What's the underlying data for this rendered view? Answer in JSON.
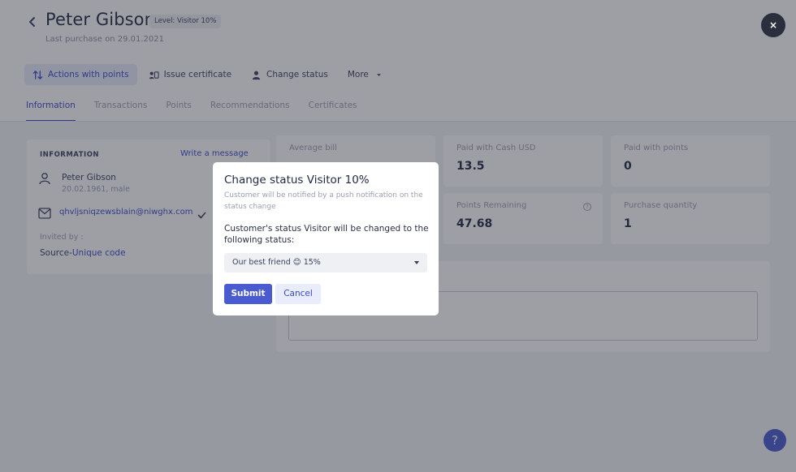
{
  "header": {
    "title": "Peter Gibson",
    "level_badge": "Level: Visitor 10%",
    "last_purchase": "Last purchase on 29.01.2021",
    "close_label": "×"
  },
  "actions": [
    {
      "label": "Actions with points",
      "icon": "swap-arrows-icon"
    },
    {
      "label": "Issue certificate",
      "icon": "ticket-icon"
    },
    {
      "label": "Change status",
      "icon": "user-badge-icon"
    },
    {
      "label": "More",
      "icon": "caret-down-icon"
    }
  ],
  "tabs": [
    "Information",
    "Transactions",
    "Points",
    "Recommendations",
    "Certificates"
  ],
  "info": {
    "title": "INFORMATION",
    "write_message": "Write a message",
    "name": "Peter Gibson",
    "subtitle": "20.02.1961, male",
    "email": "qhvljsniqzewsblain@niwghx.com",
    "invited_by": "Invited by :",
    "source_prefix": "Source-",
    "source_link": "Unique code"
  },
  "stats": [
    {
      "label": "Average bill",
      "value": ""
    },
    {
      "label": "Paid with Cash USD",
      "value": "13.5"
    },
    {
      "label": "Paid with points",
      "value": "0"
    },
    {
      "label": "",
      "value": ""
    },
    {
      "label": "Points Remaining",
      "value": "47.68"
    },
    {
      "label": "Purchase quantity",
      "value": "1"
    }
  ],
  "help_label": "?",
  "modal": {
    "title": "Change status Visitor 10%",
    "subtitle": "Customer will be notified by a push notification on the status change",
    "description": "Customer's status Visitor will be changed to the following status:",
    "select_value": "Our best friend 😊 15%",
    "submit": "Submit",
    "cancel": "Cancel"
  },
  "colors": {
    "accent": "#4a5ad0",
    "accent_text": "#3a4ac8",
    "overlay": "#282a38"
  }
}
